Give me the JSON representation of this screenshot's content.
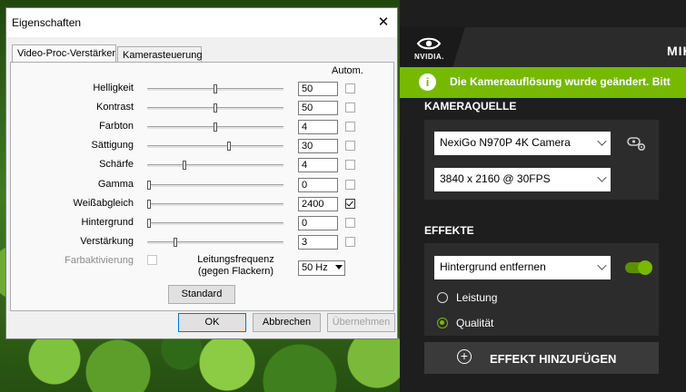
{
  "dialog": {
    "title": "Eigenschaften",
    "tabs": [
      "Video-Proc-Verstärker",
      "Kamerasteuerung"
    ],
    "auto_header": "Autom.",
    "properties": [
      {
        "label": "Helligkeit",
        "value": "50",
        "slider": 0.5,
        "auto": false
      },
      {
        "label": "Kontrast",
        "value": "50",
        "slider": 0.5,
        "auto": false
      },
      {
        "label": "Farbton",
        "value": "4",
        "slider": 0.5,
        "auto": false
      },
      {
        "label": "Sättigung",
        "value": "30",
        "slider": 0.6,
        "auto": false
      },
      {
        "label": "Schärfe",
        "value": "4",
        "slider": 0.27,
        "auto": false
      },
      {
        "label": "Gamma",
        "value": "0",
        "slider": 0.0,
        "auto": false
      },
      {
        "label": "Weißabgleich",
        "value": "2400",
        "slider": 0.0,
        "auto": true
      },
      {
        "label": "Hintergrund",
        "value": "0",
        "slider": 0.0,
        "auto": false
      },
      {
        "label": "Verstärkung",
        "value": "3",
        "slider": 0.2,
        "auto": false
      }
    ],
    "color_enable_label": "Farbaktivierung",
    "powerline_label_1": "Leitungsfrequenz",
    "powerline_label_2": "(gegen Flackern)",
    "powerline_value": "50 Hz",
    "default_button": "Standard",
    "ok_button": "OK",
    "cancel_button": "Abbrechen",
    "apply_button": "Übernehmen"
  },
  "nvidia": {
    "logo_text": "NVIDIA.",
    "title": "MIKRO",
    "banner_text": "Die Kameraauflösung wurde geändert. Bitt",
    "banner_icon": "info-icon",
    "camera_section": "KAMERAQUELLE",
    "camera_device": "NexiGo N970P 4K Camera",
    "camera_resolution": "3840 x 2160 @ 30FPS",
    "camera_settings_icon": "camera-settings-icon",
    "effects_section": "EFFEKTE",
    "effect_selected": "Hintergrund entfernen",
    "effect_enabled": true,
    "quality_options": [
      "Leistung",
      "Qualität"
    ],
    "quality_selected": "Qualität",
    "add_effect_button": "EFFEKT HINZUFÜGEN",
    "accent_color": "#76b900"
  }
}
